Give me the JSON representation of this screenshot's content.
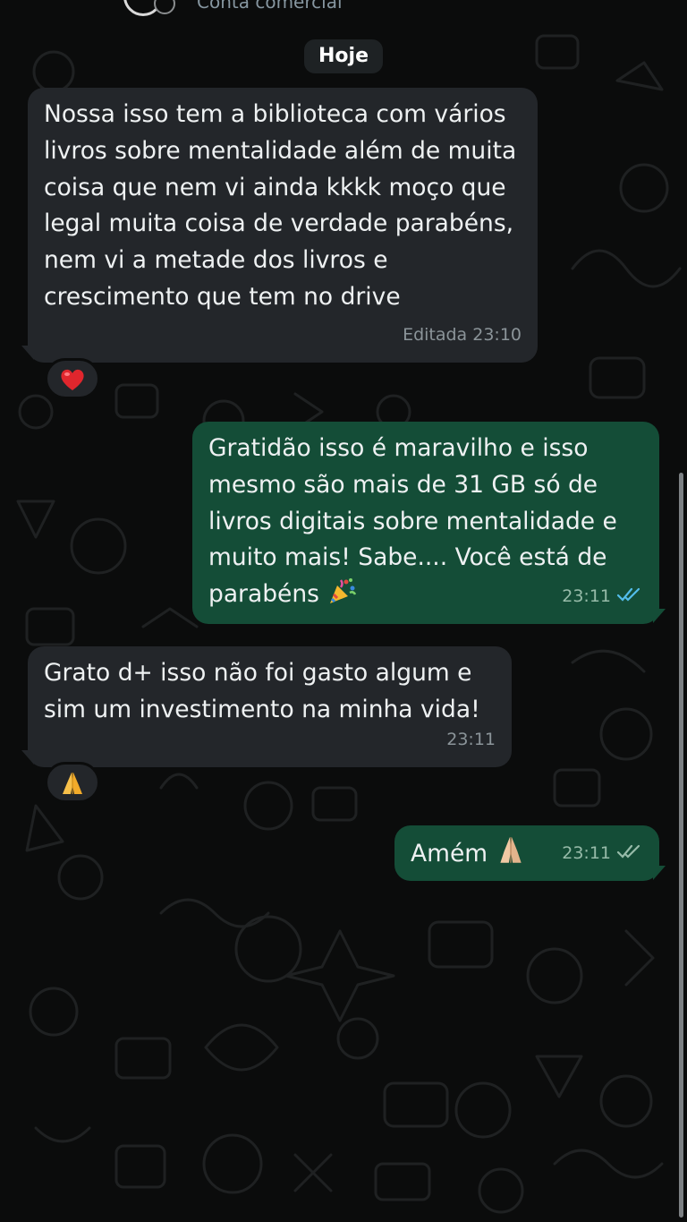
{
  "header": {
    "subtitle": "Conta comercial"
  },
  "date_separator": "Hoje",
  "messages": [
    {
      "direction": "incoming",
      "text": "Nossa isso tem a biblioteca com vários livros sobre mentalidade além de muita coisa que nem vi ainda kkkk moço que legal muita coisa de verdade parabéns, nem vi a metade dos livros e crescimento que tem no drive",
      "meta": "Editada 23:10",
      "reaction": "red-heart"
    },
    {
      "direction": "outgoing",
      "text": "Gratidão isso é maravilho e isso mesmo são mais de 31 GB só de livros digitais sobre mentalidade e muito mais! Sabe.... Você está de parabéns",
      "emoji": "party-popper",
      "meta": "23:11",
      "status": "read",
      "status_color": "#53bdeb"
    },
    {
      "direction": "incoming",
      "text": "Grato d+ isso não foi gasto algum e sim um investimento na minha vida!",
      "meta": "23:11",
      "reaction": "folded-hands"
    },
    {
      "direction": "outgoing",
      "text": "Amém",
      "emoji": "folded-hands",
      "meta": "23:11",
      "status": "delivered",
      "status_color": "#97bba9"
    }
  ],
  "colors": {
    "background": "#0b0c0c",
    "incoming_bubble": "#23262a",
    "outgoing_bubble": "#144d37",
    "date_pill": "#1e2224"
  }
}
